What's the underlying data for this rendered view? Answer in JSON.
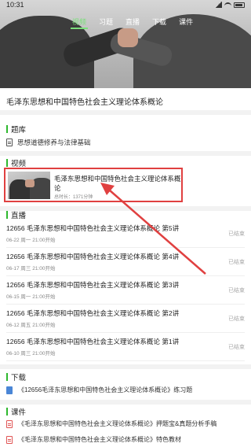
{
  "status_bar": {
    "time": "10:31"
  },
  "header": {
    "tabs": [
      {
        "label": "视频"
      },
      {
        "label": "习题"
      },
      {
        "label": "直播"
      },
      {
        "label": "下载"
      },
      {
        "label": "课件"
      }
    ],
    "active_tab_index": 0
  },
  "course": {
    "title": "毛泽东思想和中国特色社会主义理论体系概论"
  },
  "question_bank": {
    "section_title": "题库",
    "items": [
      {
        "label": "思想道德修养与法律基础"
      }
    ]
  },
  "video": {
    "section_title": "视频",
    "title": "毛泽东思想和中国特色社会主义理论体系概论",
    "duration": "总时长：1371分钟"
  },
  "live": {
    "section_title": "直播",
    "items": [
      {
        "title": "12656 毛泽东思想和中国特色社会主义理论体系概论 第5讲",
        "date": "06-22 周一  21:00开始",
        "status": "已结束"
      },
      {
        "title": "12656 毛泽东思想和中国特色社会主义理论体系概论 第4讲",
        "date": "06-17 周三  21:00开始",
        "status": "已结束"
      },
      {
        "title": "12656 毛泽东思想和中国特色社会主义理论体系概论 第3讲",
        "date": "06-15 周一  21:00开始",
        "status": "已结束"
      },
      {
        "title": "12656 毛泽东思想和中国特色社会主义理论体系概论 第2讲",
        "date": "06-12 周五  21:00开始",
        "status": "已结束"
      },
      {
        "title": "12656 毛泽东思想和中国特色社会主义理论体系概论 第1讲",
        "date": "06-10 周三  21:00开始",
        "status": "已结束"
      }
    ]
  },
  "download": {
    "section_title": "下载",
    "items": [
      {
        "label": "《12656毛泽东思想和中国特色社会主义理论体系概论》练习题"
      }
    ]
  },
  "courseware": {
    "section_title": "课件",
    "items": [
      {
        "label": "《毛泽东思想和中国特色社会主义理论体系概论》押题宝&真题分析手稿"
      },
      {
        "label": "《毛泽东思想和中国特色社会主义理论体系概论》特色教材"
      }
    ]
  },
  "colors": {
    "accent": "#2eb82e",
    "highlight": "#e04040"
  }
}
